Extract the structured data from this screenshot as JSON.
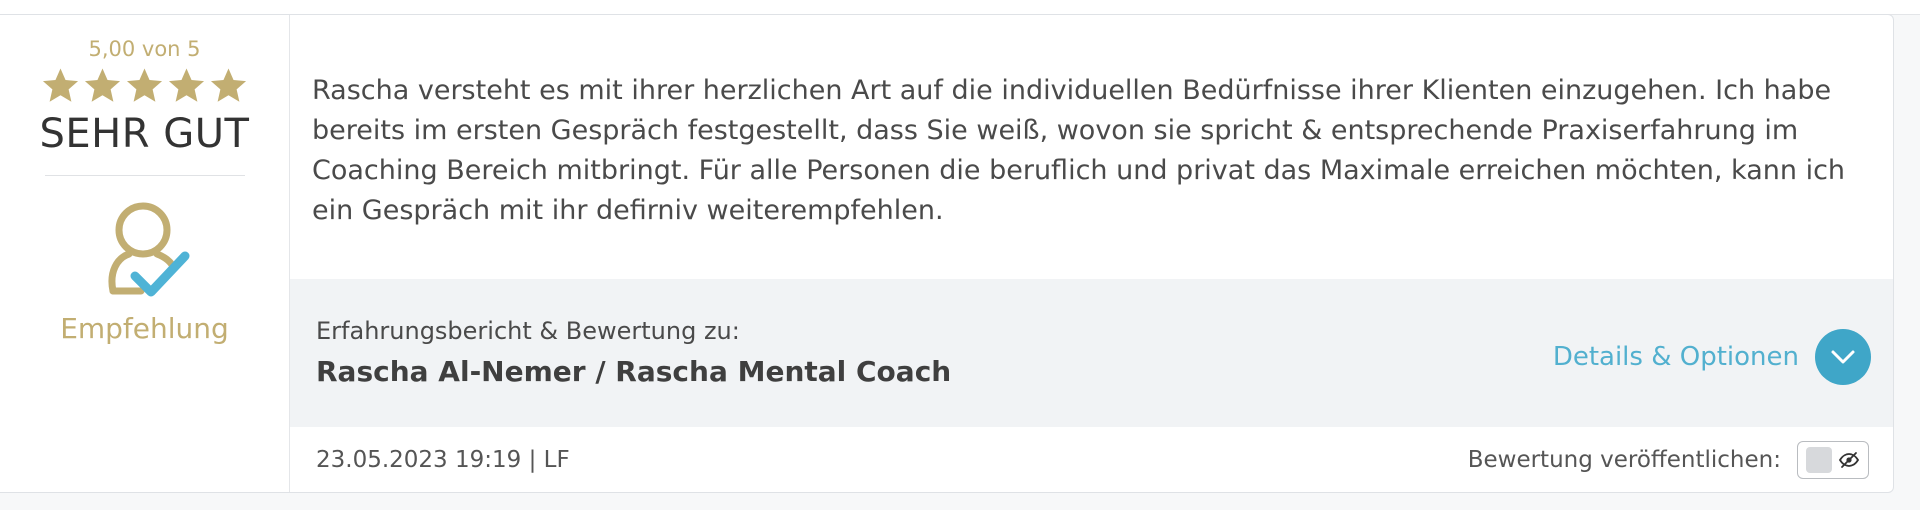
{
  "rating": {
    "score_text": "5,00 von 5",
    "stars_filled": 5,
    "stars_total": 5,
    "grade": "SEHR GUT",
    "recommendation_label": "Empfehlung",
    "icon": "user-check-icon"
  },
  "review": {
    "text": "Rascha versteht es mit ihrer herzlichen Art auf die individuellen Bedürfnisse ihrer Klienten einzugehen. Ich habe bereits im ersten Gespräch festgestellt, dass Sie weiß, wovon sie spricht & entsprechende Praxiserfahrung im Coaching Bereich mitbringt. Für alle Personen die beruflich und privat das Maximale erreichen möchten, kann ich ein Gespräch mit ihr defirniv weiterempfehlen."
  },
  "subject": {
    "label": "Erfahrungsbericht & Bewertung zu:",
    "name": "Rascha Al-Nemer / Rascha Mental Coach",
    "details_label": "Details & Optionen",
    "details_icon": "chevron-down-icon"
  },
  "footer": {
    "meta": "23.05.2023 19:19 | LF",
    "publish_label": "Bewertung veröffentlichen:",
    "publish_state": "off",
    "publish_icon": "eye-slash-icon"
  },
  "colors": {
    "gold": "#c2ae72",
    "accent_blue": "#3fa6c8",
    "link_blue": "#52b0cf",
    "check_blue": "#4fb3d6"
  }
}
